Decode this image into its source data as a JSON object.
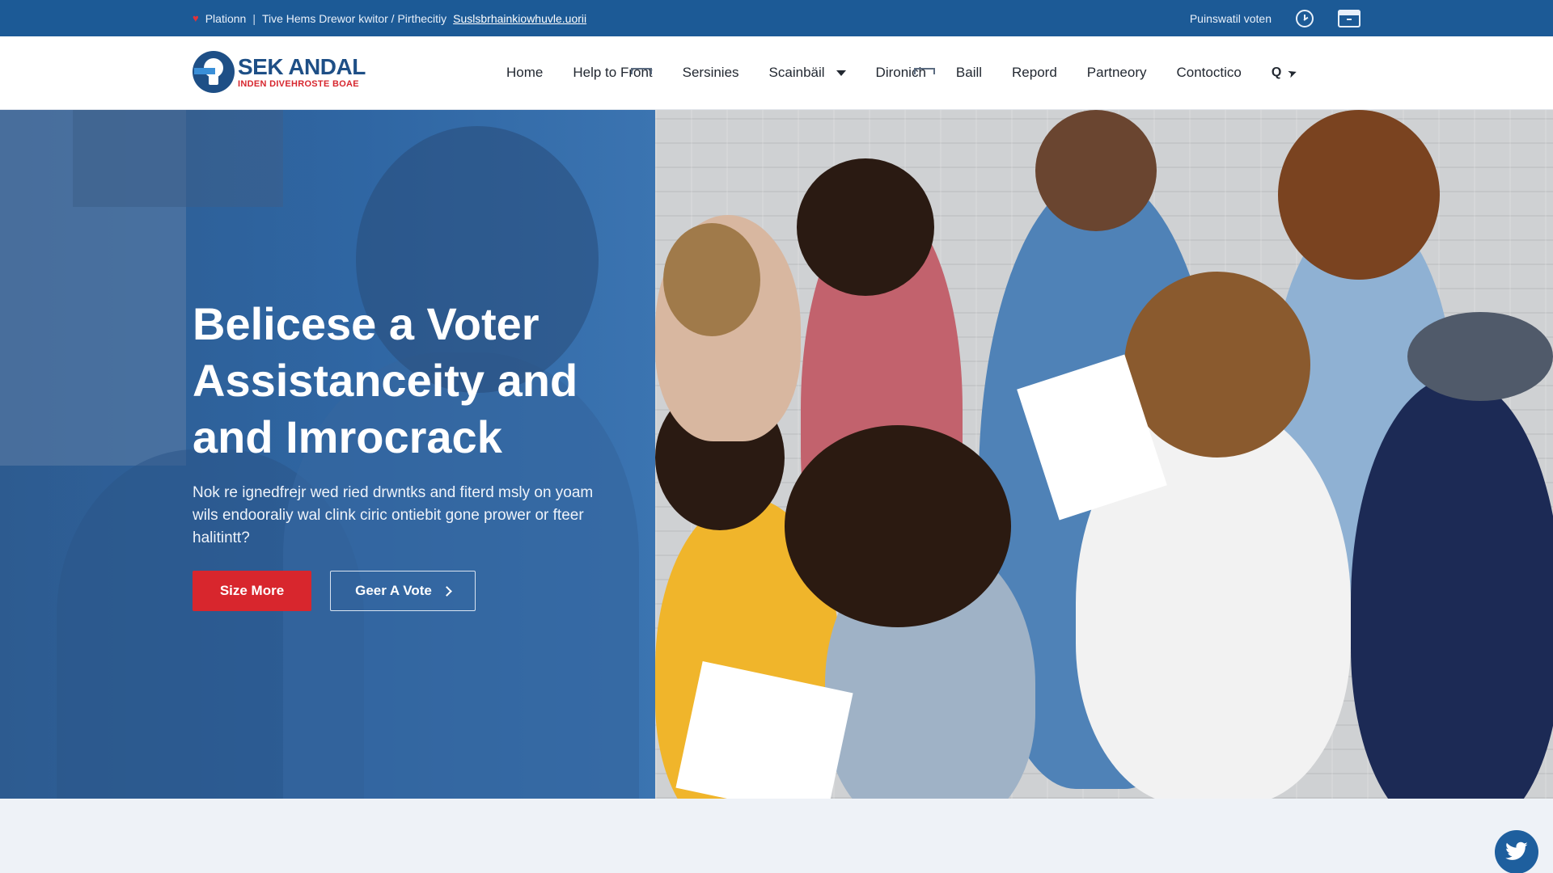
{
  "topbar": {
    "left_label": "Plationn",
    "middle_text": "Tive Hems Drewor kwitor / Pirthecitiy",
    "link_text": "Suslsbrhainkiowhuvle.uorii",
    "right_label": "Puinswatil voten"
  },
  "header": {
    "logo_name": "SEK ANDAL",
    "logo_tagline": "INDEN DIVEHROSTE BOAE"
  },
  "nav": {
    "items": [
      {
        "label": "Home"
      },
      {
        "label": "Help to Front"
      },
      {
        "label": "Sersinies"
      },
      {
        "label": "Scainbäil"
      },
      {
        "label": "Dironich"
      },
      {
        "label": "Baill"
      },
      {
        "label": "Repord"
      },
      {
        "label": "Partneory"
      },
      {
        "label": "Contoctico"
      }
    ],
    "search_label": "Q"
  },
  "hero": {
    "title": "Belicese a Voter Assistanceity and and Imrocrack",
    "description": "Nok re ignedfrejr wed ried drwntks and fiterd msly on yoam wils endooraliy wal clink ciric ontiebit gone prower or fteer halitintt?",
    "primary_button": "Size More",
    "secondary_button": "Geer A Vote"
  },
  "colors": {
    "topbar": "#1c5a96",
    "brand_blue": "#1e4f86",
    "accent_red": "#d8262d",
    "hero_overlay": "#2f66a3"
  },
  "icons": [
    "heart-icon",
    "clock-icon",
    "inbox-icon",
    "logo-icon",
    "chevron-down-icon",
    "search-icon",
    "cursor-icon",
    "chevron-right-icon",
    "twitter-icon"
  ]
}
